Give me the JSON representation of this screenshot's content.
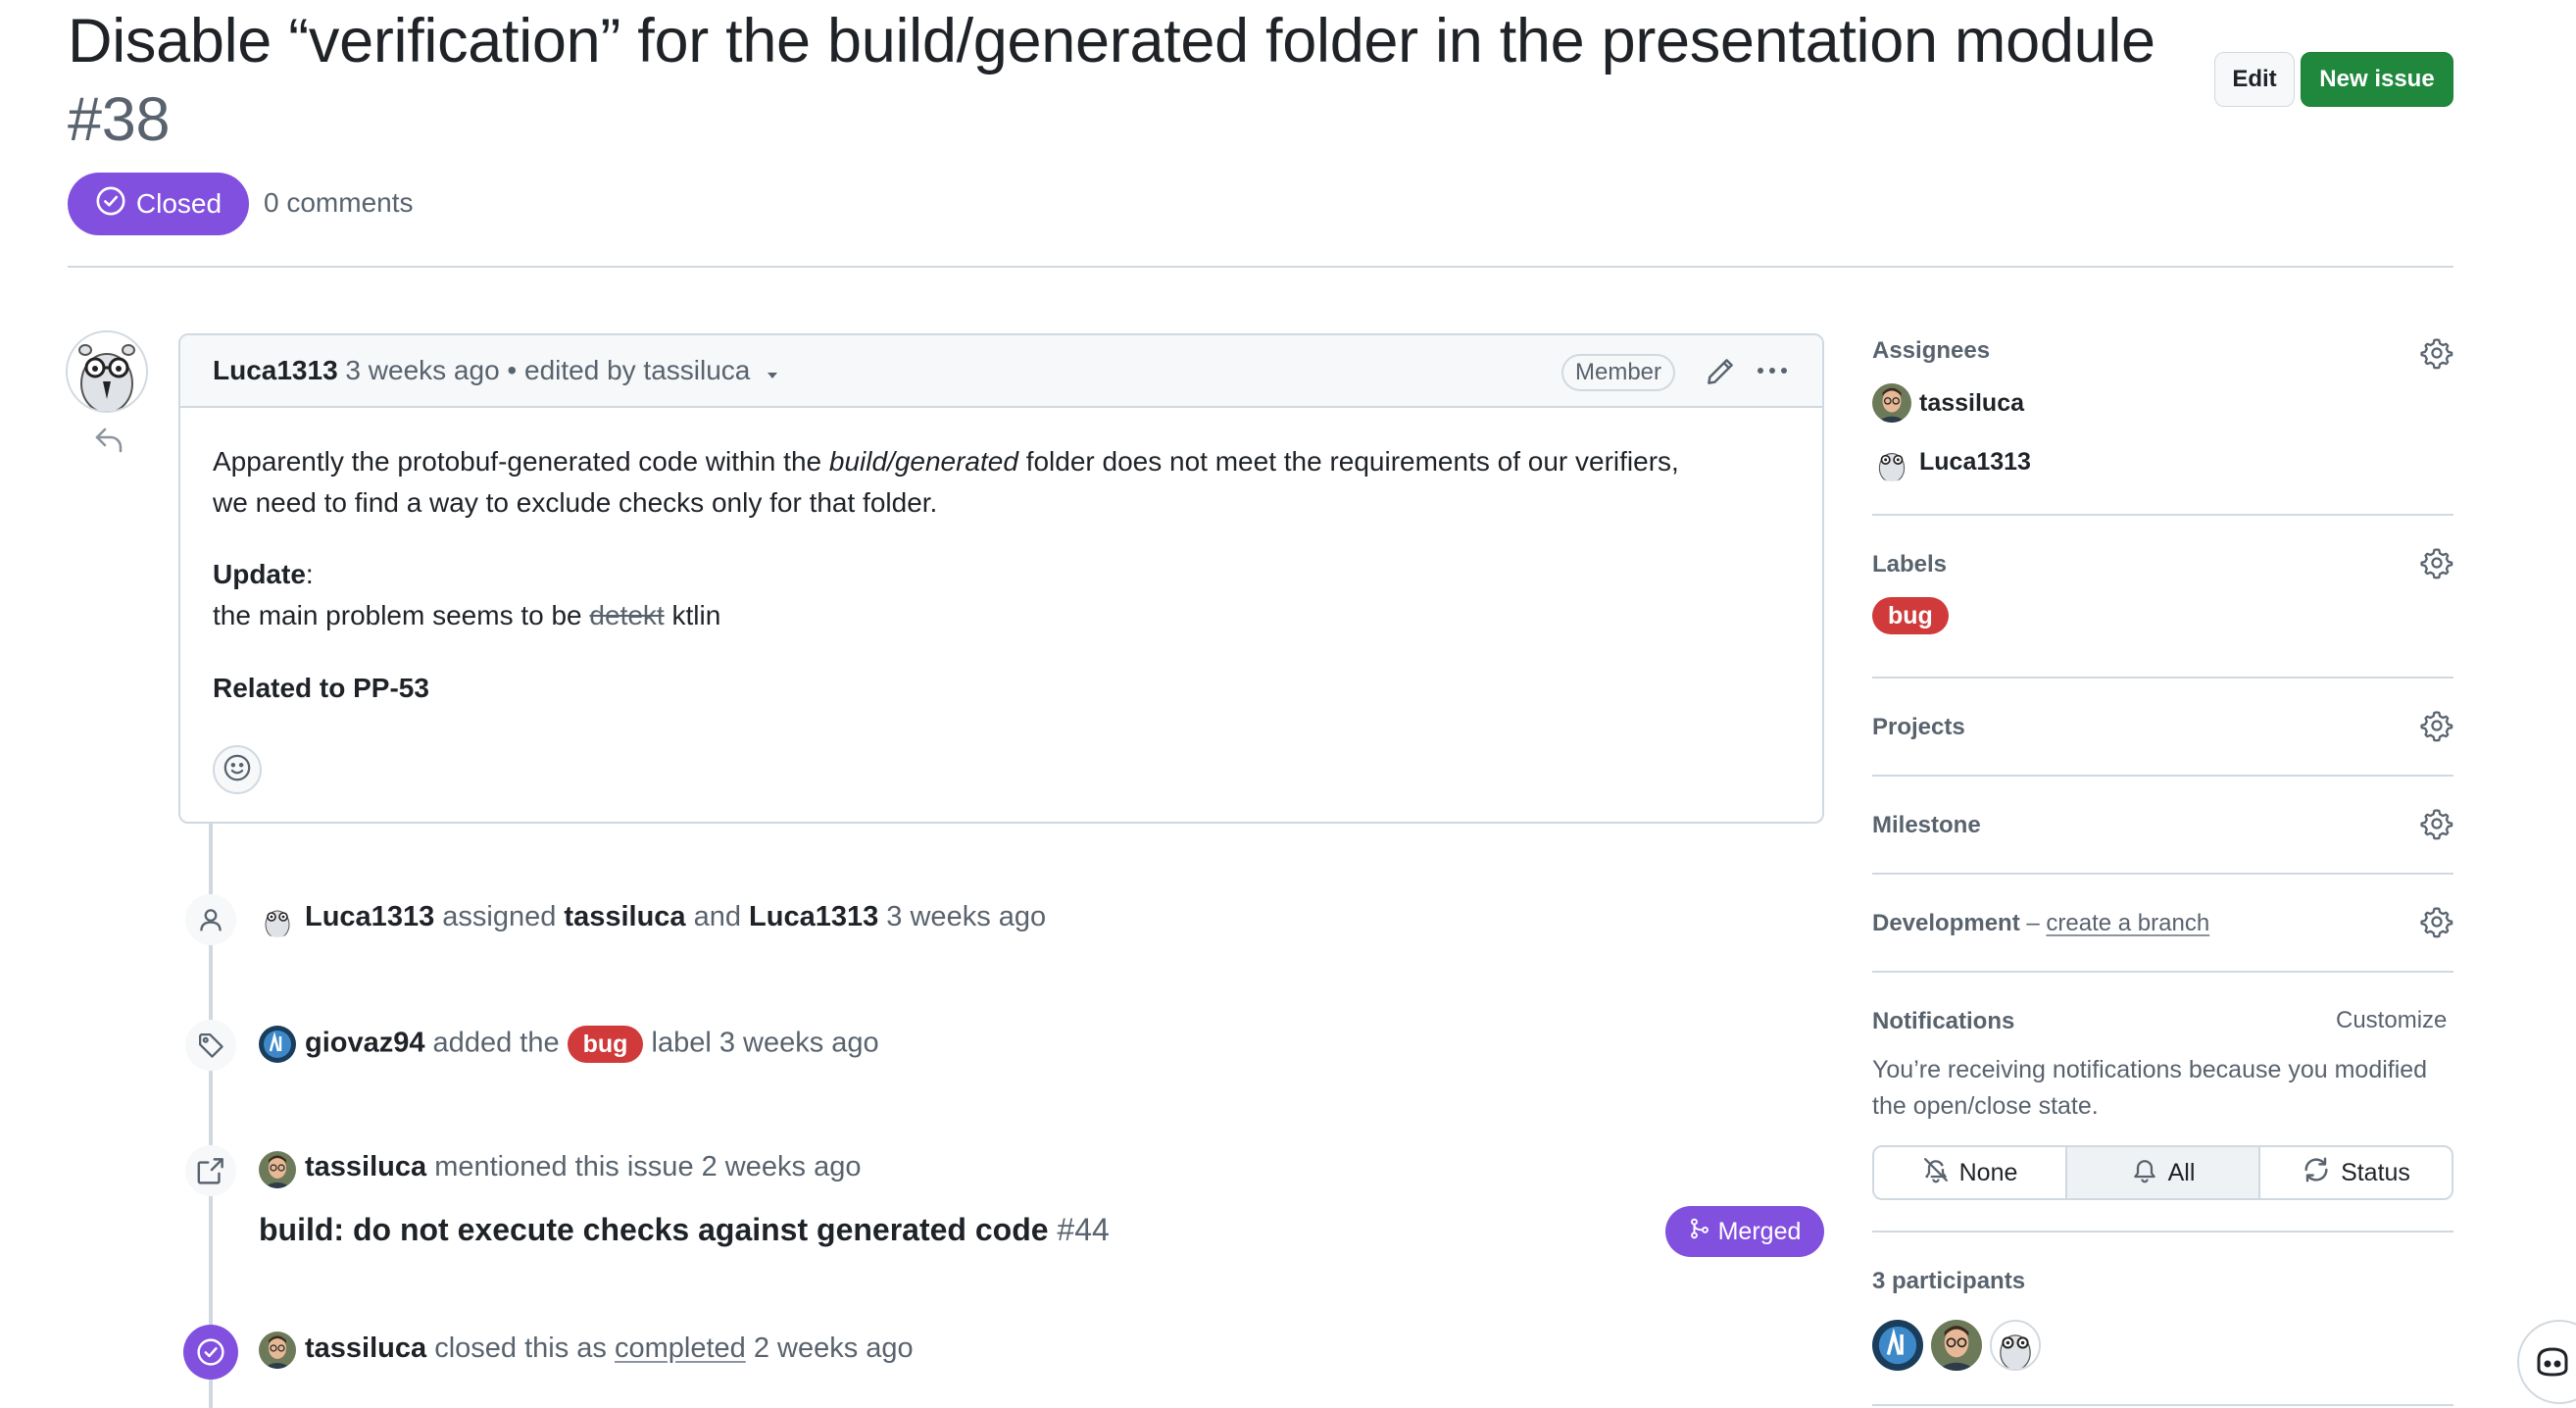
{
  "header": {
    "title": "Disable “verification” for the build/generated folder in the presentation module",
    "number": "#38",
    "edit_label": "Edit",
    "new_issue_label": "New issue",
    "state": "Closed",
    "comments": "0 comments"
  },
  "comment": {
    "author": "Luca1313",
    "time": "3 weeks ago",
    "separator": "•",
    "edited": "edited by tassiluca",
    "member_badge": "Member",
    "body_line1_pre": "Apparently the protobuf-generated code within the ",
    "body_line1_em": "build/generated",
    "body_line1_post": " folder does not meet the requirements of our verifiers,",
    "body_line2": "we need to find a way to exclude checks only for that folder.",
    "update_label": "Update",
    "update_colon": ":",
    "update_pre": "the main problem seems to be ",
    "update_strike": "detekt",
    "update_post": " ktlin",
    "related": "Related to PP-53"
  },
  "timeline": {
    "assigned": {
      "actor": "Luca1313",
      "verb": " assigned ",
      "user1": "tassiluca",
      "and": " and ",
      "user2": "Luca1313",
      "time": " 3 weeks ago"
    },
    "labeled": {
      "actor": "giovaz94",
      "verb": " added the ",
      "label": "bug",
      "suffix": " label 3 weeks ago"
    },
    "mentioned": {
      "actor": "tassiluca",
      "text": " mentioned this issue 2 weeks ago",
      "pr_title": "build: do not execute checks against generated code",
      "pr_number": " #44",
      "pr_state": "Merged"
    },
    "closed": {
      "actor": "tassiluca",
      "pre": " closed this as ",
      "link": "completed",
      "time": " 2 weeks ago"
    }
  },
  "sidebar": {
    "assignees_heading": "Assignees",
    "assignees": [
      "tassiluca",
      "Luca1313"
    ],
    "labels_heading": "Labels",
    "label": "bug",
    "projects_heading": "Projects",
    "milestone_heading": "Milestone",
    "development_heading": "Development",
    "development_dash": " – ",
    "development_link": "create a branch",
    "notifications_heading": "Notifications",
    "customize": "Customize",
    "notifications_desc": "You’re receiving notifications because you modified the open/close state.",
    "notif_options": [
      "None",
      "All",
      "Status"
    ],
    "notif_selected": "All",
    "participants_heading": "3 participants"
  },
  "colors": {
    "closed_purple": "#8250df",
    "new_issue_green": "#1f883d",
    "bug_label_red": "#d03a3a"
  },
  "icons": [
    "closed-check-icon",
    "kebab-more-icon",
    "pencil-icon",
    "reply-icon",
    "smiley-icon",
    "person-icon",
    "tag-icon",
    "cross-reference-icon",
    "merge-icon",
    "gear-icon",
    "bell-slash-icon",
    "bell-icon",
    "sync-icon",
    "copilot-icon"
  ]
}
